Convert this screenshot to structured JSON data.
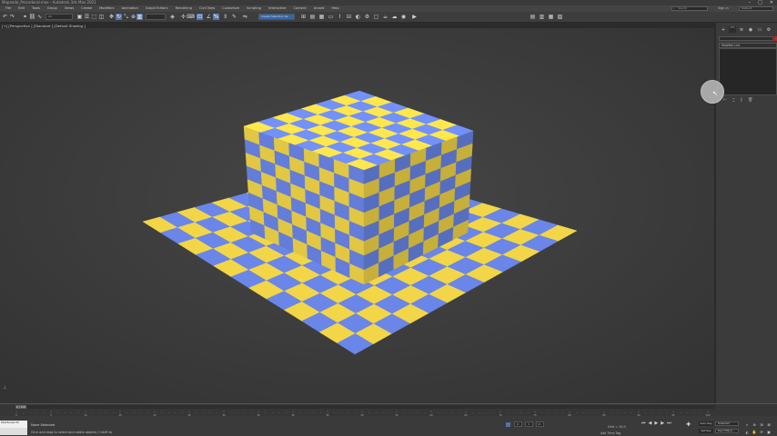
{
  "window": {
    "title": "Mapeado_Procedural.max - Autodesk 3ds Max 2021",
    "controls": [
      "–",
      "□",
      "✕"
    ]
  },
  "menubar": {
    "items": [
      "File",
      "Edit",
      "Tools",
      "Group",
      "Views",
      "Create",
      "Modifiers",
      "Animation",
      "Graph Editors",
      "Rendering",
      "Civil View",
      "Customize",
      "Scripting",
      "Interactive",
      "Content",
      "Arnold",
      "Help"
    ],
    "search_placeholder": "Search",
    "user_label": "Sign In",
    "workspace_label": "Default"
  },
  "toolbar": {
    "selection_filter": "All",
    "named_selection": "Create Selection Se"
  },
  "viewport": {
    "label": "[+] [Perspective ] [Standard ] [Default Shading ]",
    "checker_colors": {
      "yellow": "#f2d648",
      "blue": "#6a86e8"
    },
    "background": "#404040"
  },
  "command_panel": {
    "tabs": [
      "+",
      "⌒",
      "≡",
      "◉",
      "▭",
      "⚙"
    ],
    "modifier_list": "Modifier List"
  },
  "timeline": {
    "frame_label": "0 / 100",
    "ticks": [
      "0",
      "5",
      "10",
      "15",
      "20",
      "25",
      "30",
      "35",
      "40",
      "45",
      "50",
      "55",
      "60",
      "65",
      "70",
      "75",
      "80",
      "85",
      "90",
      "95",
      "100"
    ]
  },
  "statusbar": {
    "maxscript": "MAXScript Mi",
    "status_line": "None Selected",
    "prompt_line": "Click and drag to select and rotate objects (+shift to",
    "x_label": "X:",
    "y_label": "Y:",
    "z_label": "Z:",
    "grid": "Grid = 10,0",
    "add_time_tag": "Add Time Tag",
    "auto_key": "Auto Key",
    "set_key": "Set Key",
    "selected": "Selected",
    "key_filters": "Key Filters..."
  }
}
